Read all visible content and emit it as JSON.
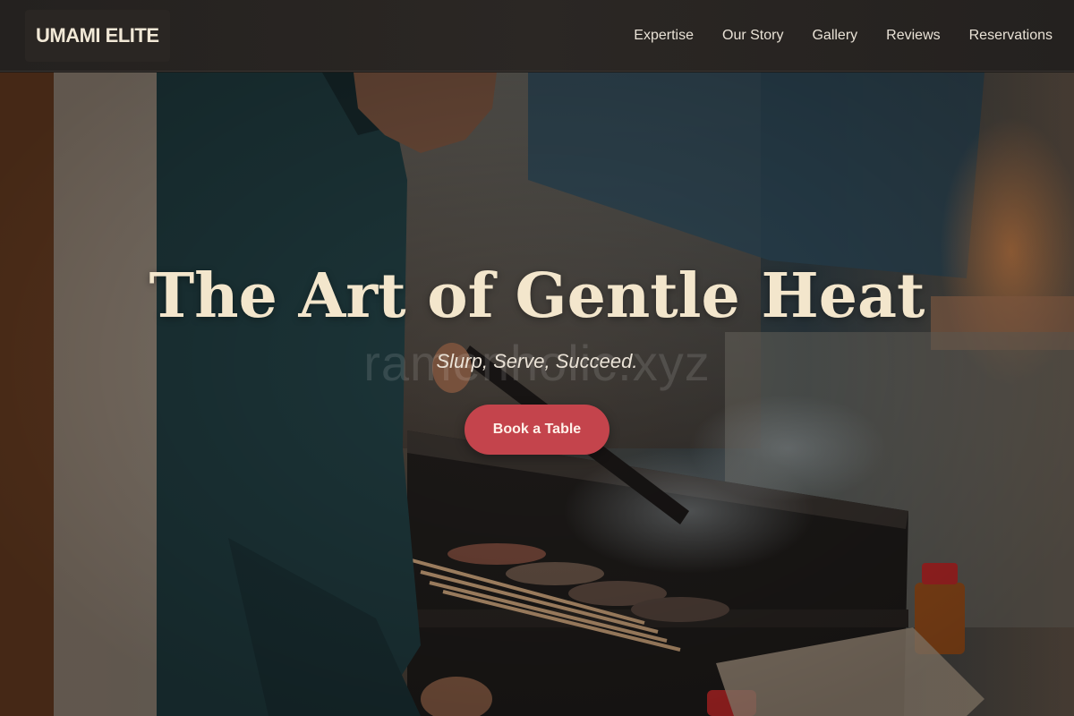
{
  "header": {
    "logo": "UMAMI ELITE",
    "nav": [
      "Expertise",
      "Our Story",
      "Gallery",
      "Reviews",
      "Reservations"
    ]
  },
  "hero": {
    "title": "The Art of Gentle Heat",
    "subtitle": "Slurp, Serve, Succeed.",
    "watermark": "ramenholic.xyz",
    "cta_label": "Book a Table",
    "image_description": "chef grilling yakitori skewers over a charcoal grill"
  },
  "colors": {
    "header_bg": "#2b2724",
    "title": "#f3e6cc",
    "cta_bg": "#c4444c"
  }
}
